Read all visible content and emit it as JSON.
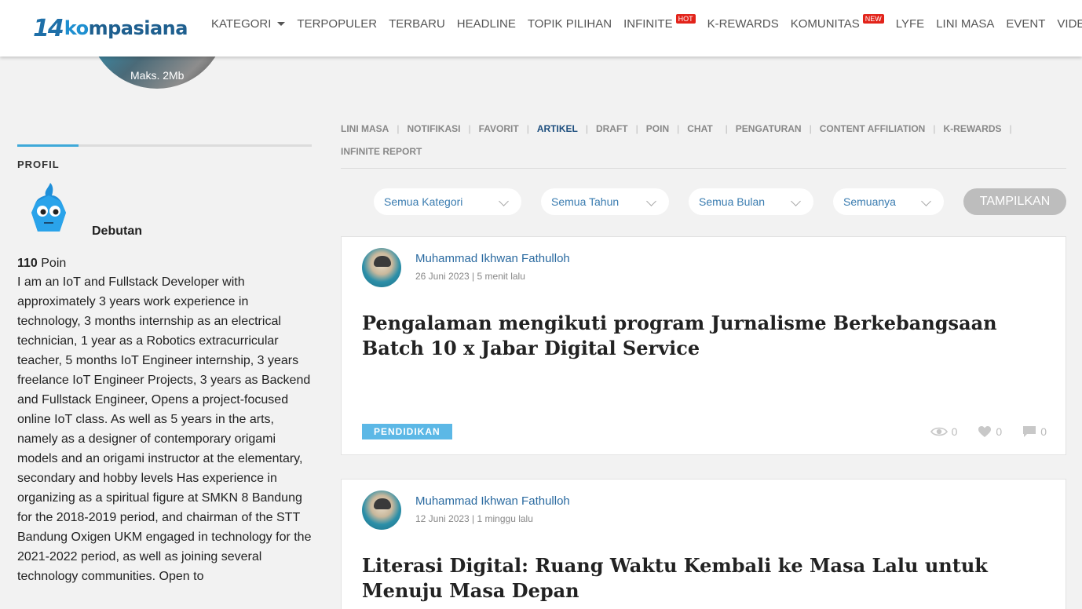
{
  "header": {
    "logo_mark": "14",
    "logo_ko": "ko",
    "logo_rest": "mpasiana",
    "nav": [
      {
        "label": "KATEGORI",
        "caret": true
      },
      {
        "label": "TERPOPULER"
      },
      {
        "label": "TERBARU"
      },
      {
        "label": "HEADLINE"
      },
      {
        "label": "TOPIK PILIHAN"
      },
      {
        "label": "INFINITE",
        "badge": "HOT"
      },
      {
        "label": "K-REWARDS"
      },
      {
        "label": "KOMUNITAS",
        "badge": "NEW"
      },
      {
        "label": "LYFE"
      },
      {
        "label": "LINI MASA"
      },
      {
        "label": "EVENT"
      },
      {
        "label": "VIDEO"
      }
    ]
  },
  "cover": {
    "max_size": "Maks. 2Mb"
  },
  "profile": {
    "heading": "PROFIL",
    "rank": "Debutan",
    "points_value": "110",
    "points_label": " Poin",
    "bio": "I am an IoT and Fullstack Developer with approximately 3 years work experience in technology, 3 months internship as an electrical technician, 1 year as a Robotics extracurricular teacher, 5 months IoT Engineer internship, 3 years freelance IoT Engineer Projects, 3 years as Backend and Fullstack Engineer, Opens a project-focused online IoT class. As well as 5 years in the arts, namely as a designer of contemporary origami models and an origami instructor at the elementary, secondary and hobby levels Has experience in organizing as a spiritual figure at SMKN 8 Bandung for the 2018-2019 period, and chairman of the STT Bandung Oxigen UKM engaged in technology for the 2021-2022 period, as well as joining several technology communities. Open to"
  },
  "tabs": [
    {
      "label": "LINI MASA"
    },
    {
      "label": "NOTIFIKASI"
    },
    {
      "label": "FAVORIT"
    },
    {
      "label": "ARTIKEL",
      "active": true
    },
    {
      "label": "DRAFT"
    },
    {
      "label": "POIN"
    },
    {
      "label": "CHAT"
    },
    {
      "label": "PENGATURAN"
    },
    {
      "label": "CONTENT AFFILIATION"
    },
    {
      "label": "K-REWARDS"
    },
    {
      "label": "INFINITE REPORT"
    }
  ],
  "filters": {
    "kategori": "Semua Kategori",
    "tahun": "Semua Tahun",
    "bulan": "Semua Bulan",
    "jenis": "Semuanya",
    "show_button": "TAMPILKAN"
  },
  "articles": [
    {
      "author": "Muhammad Ikhwan Fathulloh",
      "date": "26 Juni 2023 | 5 menit lalu",
      "title": "Pengalaman mengikuti program Jurnalisme Berkebangsaan Batch 10 x Jabar Digital Service",
      "category": "PENDIDIKAN",
      "views": "0",
      "likes": "0",
      "comments": "0"
    },
    {
      "author": "Muhammad Ikhwan Fathulloh",
      "date": "12 Juni 2023 | 1 minggu lalu",
      "title": "Literasi Digital: Ruang Waktu Kembali ke Masa Lalu untuk Menuju Masa Depan"
    }
  ]
}
